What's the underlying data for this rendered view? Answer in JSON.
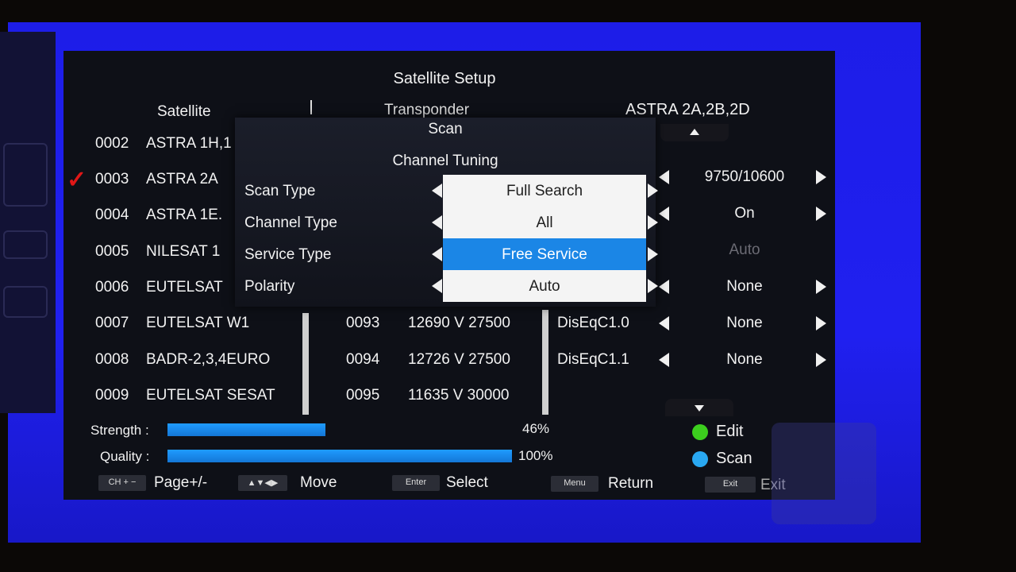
{
  "title": "Satellite Setup",
  "columns": {
    "satellite": "Satellite",
    "transponder": "Transponder",
    "satellite_name": "ASTRA 2A,2B,2D"
  },
  "satellites": [
    {
      "num": "0002",
      "name": "ASTRA 1H,1"
    },
    {
      "num": "0003",
      "name": "ASTRA 2A",
      "checked": true
    },
    {
      "num": "0004",
      "name": "ASTRA 1E."
    },
    {
      "num": "0005",
      "name": "NILESAT 1"
    },
    {
      "num": "0006",
      "name": "EUTELSAT"
    },
    {
      "num": "0007",
      "name": "EUTELSAT W1"
    },
    {
      "num": "0008",
      "name": "BADR-2,3,4EURO"
    },
    {
      "num": "0009",
      "name": "EUTELSAT SESAT"
    }
  ],
  "transponders": [
    {
      "num": "0093",
      "value": "12690 V 27500"
    },
    {
      "num": "0094",
      "value": "12726 V 27500"
    },
    {
      "num": "0095",
      "value": "11635 V 30000"
    }
  ],
  "params": [
    {
      "label": "",
      "value": "9750/10600"
    },
    {
      "label": "",
      "value": "On"
    },
    {
      "label": "",
      "value": "Auto"
    },
    {
      "label": "",
      "value": "None"
    },
    {
      "label": "DisEqC1.0",
      "value": "None"
    },
    {
      "label": "DisEqC1.1",
      "value": "None"
    }
  ],
  "scan_dialog": {
    "title": "Scan",
    "subtitle": "Channel Tuning",
    "rows": [
      {
        "label": "Scan Type",
        "value": "Full Search"
      },
      {
        "label": "Channel Type",
        "value": "All"
      },
      {
        "label": "Service Type",
        "value": "Free Service"
      },
      {
        "label": "Polarity",
        "value": "Auto"
      }
    ],
    "selected_index": 2
  },
  "signal": {
    "strength_label": "Strength :",
    "strength_pct": "46%",
    "strength_value": 0.46,
    "quality_label": "Quality :",
    "quality_pct": "100%",
    "quality_value": 1.0
  },
  "legend": [
    {
      "label": "Edit",
      "color": "#3ccf1e"
    },
    {
      "label": "Scan",
      "color": "#29a8f2"
    }
  ],
  "keys": [
    {
      "cap": "CH + −",
      "label": "Page+/-"
    },
    {
      "cap": "▲▼◀▶",
      "label": "Move"
    },
    {
      "cap": "Enter",
      "label": "Select"
    },
    {
      "cap": "Menu",
      "label": "Return"
    },
    {
      "cap": "Exit",
      "label": "Exit"
    }
  ],
  "colors": {
    "accent": "#1b86e6",
    "osd_bg": "#0e1017",
    "screen_blue": "#2020f0",
    "check_red": "#e01717"
  }
}
